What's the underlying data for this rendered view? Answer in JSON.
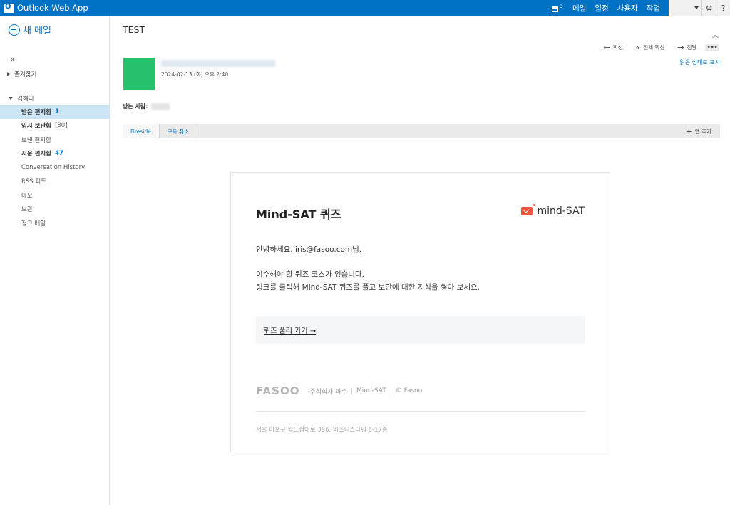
{
  "app": {
    "title": "Outlook Web App"
  },
  "topnav": {
    "calendar_count": "3",
    "items": [
      "메일",
      "일정",
      "사용자",
      "작업"
    ]
  },
  "sidebar": {
    "new_mail": "새 메일",
    "collapse_glyph": "«",
    "favorites": "즐겨찾기",
    "account": "김혜리",
    "folders": [
      {
        "label": "받은 편지함",
        "count": "1"
      },
      {
        "label": "임시 보관함",
        "count": "[80]"
      },
      {
        "label": "보낸 편지함",
        "count": ""
      },
      {
        "label": "지운 편지함",
        "count": "47"
      },
      {
        "label": "Conversation History",
        "count": ""
      },
      {
        "label": "RSS 피드",
        "count": ""
      },
      {
        "label": "메모",
        "count": ""
      },
      {
        "label": "보관",
        "count": ""
      },
      {
        "label": "정크 메일",
        "count": ""
      }
    ]
  },
  "message": {
    "subject": "TEST",
    "date": "2024-02-13 (화) 오후 2:40",
    "to_label": "받는 사람:",
    "actions": {
      "reply": "회신",
      "reply_all": "전체 회신",
      "forward": "전달"
    },
    "mark_read": "읽은 상태로 표시"
  },
  "apps": {
    "tabs": [
      "Fireside",
      "구독 취소"
    ],
    "add": "앱 추가"
  },
  "email": {
    "title": "Mind-SAT 퀴즈",
    "brand": "mind-SAT",
    "greeting": "안녕하세요. iris@fasoo.com님.",
    "line1": "이수해야 할 퀴즈 코스가 있습니다.",
    "line2": "링크를 클릭해 Mind-SAT 퀴즈를 풀고 보안에 대한 지식을 쌓아 보세요.",
    "cta": "퀴즈 풀러 가기 →",
    "footer_logo": "FASOO",
    "footer_items": [
      "주식회사 파수",
      "Mind-SAT",
      "© Fasoo"
    ],
    "address": "서울 마포구 월드컵대로 396, 비즈니스타워 6-17층"
  },
  "colors": {
    "brand": "#0072c6",
    "avatar": "#27c16d",
    "accent": "#f0533c"
  }
}
